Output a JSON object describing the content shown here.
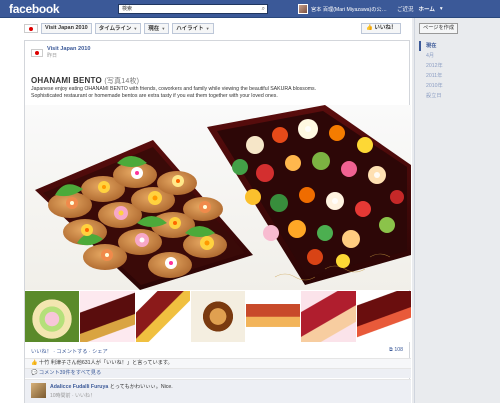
{
  "topbar": {
    "logo": "facebook",
    "search_value": "検索",
    "user_name": "宮本 百理(Mari Miyazawa)の公…",
    "links": [
      "ご近況",
      "ホーム"
    ]
  },
  "header": {
    "page_name": "Visit Japan 2010",
    "tab_timeline": "タイムライン",
    "tab_now": "現在",
    "tab_highlight": "ハイライト",
    "like_button": "いいね！",
    "create_page_button": "ページを作成"
  },
  "years": [
    "現在",
    "4月",
    "2012年",
    "2011年",
    "2010年",
    "設立日"
  ],
  "post": {
    "poster_name": "Visit Japan 2010",
    "poster_time": "昨日",
    "title": "OHANAMI BENTO",
    "photo_count": "(写真14枚)",
    "body": "Japanese enjoy eating OHANAMI BENTO with friends, coworkers and family while viewing the beautiful SAKURA blossoms. Sophisticated restaurant or homemade bentos are extra tasty if you eat them together with your loved ones.",
    "actions": "いいね！ · コメントする · シェア",
    "share_count": "108",
    "likes_text": "十竹 利津子さん他631人が「いいね！」と言っています。",
    "view_comments": "コメント39件をすべて見る",
    "comment": {
      "author": "Adalicce Fudalli Furuya",
      "text": "とってもかわいぃぃ。Nice.",
      "meta": "10時間前 · いいね！"
    }
  },
  "colors": {
    "brand": "#3b5998",
    "background": "#e9ebee"
  }
}
